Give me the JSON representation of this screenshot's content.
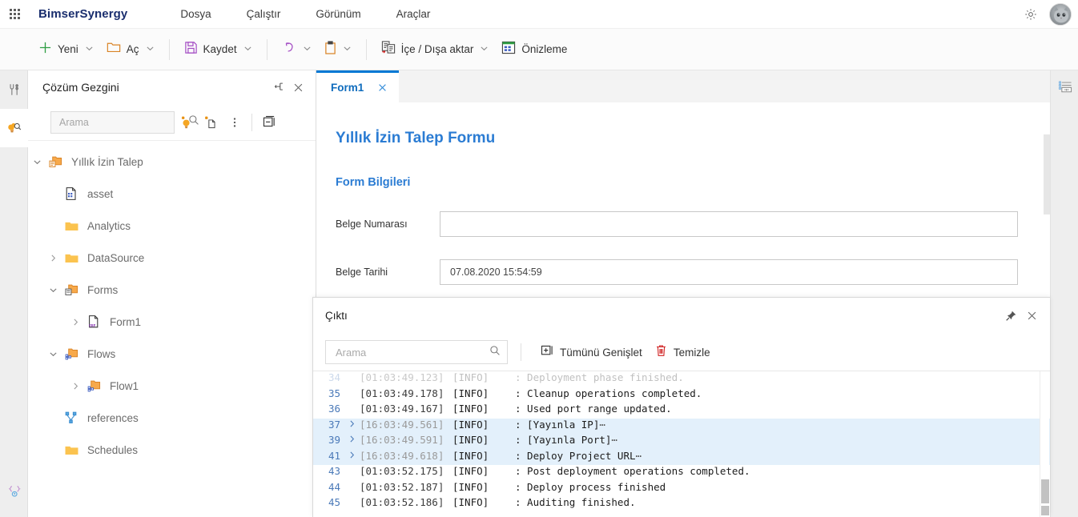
{
  "topbar": {
    "waffle_icon": "app-launcher-icon",
    "brand": "BimserSynergy",
    "menu": [
      {
        "label": "Dosya"
      },
      {
        "label": "Çalıştır"
      },
      {
        "label": "Görünüm"
      },
      {
        "label": "Araçlar"
      }
    ],
    "settings_icon": "gear-icon",
    "avatar_icon": "user-avatar"
  },
  "ribbon": {
    "items": [
      {
        "label": "Yeni",
        "icon": "plus-icon",
        "caret": true
      },
      {
        "label": "Aç",
        "icon": "folder-open-icon",
        "caret": true
      },
      {
        "label": "Kaydet",
        "icon": "save-floppy-icon",
        "caret": true
      },
      {
        "label": "",
        "icon": "undo-icon",
        "caret": true
      },
      {
        "label": "",
        "icon": "clipboard-paste-icon",
        "caret": true
      },
      {
        "label": "İçe / Dışa aktar",
        "icon": "import-export-icon",
        "caret": true
      },
      {
        "label": "Önizleme",
        "icon": "preview-grid-icon",
        "caret": false
      }
    ]
  },
  "left_rail": {
    "items": [
      {
        "name": "toolbox-icon",
        "active": false
      },
      {
        "name": "solution-explorer-icon",
        "active": true
      }
    ],
    "bottom_item": {
      "name": "code-braces-icon"
    }
  },
  "right_rail": {
    "items": [
      {
        "name": "properties-panel-icon"
      }
    ]
  },
  "explorer": {
    "title": "Çözüm Gezgini",
    "pin_icon": "pin-icon",
    "close_icon": "close-icon",
    "search": {
      "placeholder": "Arama",
      "value": "",
      "icon": "search-icon"
    },
    "toolbar_icons": [
      {
        "name": "new-item-bulb-icon"
      },
      {
        "name": "new-file-icon"
      },
      {
        "name": "more-options-icon"
      },
      {
        "name": "collapse-all-icon"
      }
    ],
    "tree": [
      {
        "label": "Yıllık İzin Talep",
        "level": 0,
        "chevron": "down",
        "icon": "solution-folder-icon"
      },
      {
        "label": "asset",
        "level": 1,
        "chevron": "none",
        "icon": "asset-file-icon"
      },
      {
        "label": "Analytics",
        "level": 1,
        "chevron": "none",
        "icon": "folder-icon"
      },
      {
        "label": "DataSource",
        "level": 1,
        "chevron": "right",
        "icon": "folder-icon"
      },
      {
        "label": "Forms",
        "level": 1,
        "chevron": "down",
        "icon": "forms-folder-icon"
      },
      {
        "label": "Form1",
        "level": 2,
        "chevron": "right",
        "icon": "erf-file-icon"
      },
      {
        "label": "Flows",
        "level": 1,
        "chevron": "down",
        "icon": "flows-folder-icon"
      },
      {
        "label": "Flow1",
        "level": 2,
        "chevron": "right",
        "icon": "flow-folder-icon"
      },
      {
        "label": "references",
        "level": 1,
        "chevron": "none",
        "icon": "references-icon"
      },
      {
        "label": "Schedules",
        "level": 1,
        "chevron": "none",
        "icon": "folder-icon"
      }
    ]
  },
  "editor": {
    "tabs": [
      {
        "label": "Form1",
        "active": true,
        "close_icon": "close-icon"
      }
    ],
    "form": {
      "title": "Yıllık İzin Talep Formu",
      "section": "Form Bilgileri",
      "fields": [
        {
          "label": "Belge Numarası",
          "value": ""
        },
        {
          "label": "Belge Tarihi",
          "value": "07.08.2020 15:54:59"
        }
      ]
    }
  },
  "output": {
    "title": "Çıktı",
    "pin_icon": "pin-icon",
    "close_icon": "close-icon",
    "search": {
      "placeholder": "Arama",
      "value": "",
      "icon": "search-icon"
    },
    "buttons": [
      {
        "label": "Tümünü Genişlet",
        "icon": "expand-all-icon"
      },
      {
        "label": "Temizle",
        "icon": "trash-icon"
      }
    ],
    "log": [
      {
        "num": "34",
        "chevron": false,
        "ts": "[01:03:49.123]",
        "level": "[INFO]",
        "msg": ": Deployment phase finished.",
        "highlight": false,
        "partial": true,
        "ellipsis": false
      },
      {
        "num": "35",
        "chevron": false,
        "ts": "[01:03:49.178]",
        "level": "[INFO]",
        "msg": ": Cleanup operations completed.",
        "highlight": false,
        "partial": false,
        "ellipsis": false
      },
      {
        "num": "36",
        "chevron": false,
        "ts": "[01:03:49.167]",
        "level": "[INFO]",
        "msg": ": Used port range updated.",
        "highlight": false,
        "partial": false,
        "ellipsis": false
      },
      {
        "num": "37",
        "chevron": true,
        "ts": "[16:03:49.561]",
        "level": "[INFO]",
        "msg": ": [Yayınla IP]",
        "highlight": true,
        "partial": false,
        "ellipsis": true
      },
      {
        "num": "39",
        "chevron": true,
        "ts": "[16:03:49.591]",
        "level": "[INFO]",
        "msg": ": [Yayınla Port]",
        "highlight": true,
        "partial": false,
        "ellipsis": true
      },
      {
        "num": "41",
        "chevron": true,
        "ts": "[16:03:49.618]",
        "level": "[INFO]",
        "msg": ": Deploy Project URL",
        "highlight": true,
        "partial": false,
        "ellipsis": true
      },
      {
        "num": "43",
        "chevron": false,
        "ts": "[01:03:52.175]",
        "level": "[INFO]",
        "msg": ": Post deployment operations completed.",
        "highlight": false,
        "partial": false,
        "ellipsis": false
      },
      {
        "num": "44",
        "chevron": false,
        "ts": "[01:03:52.187]",
        "level": "[INFO]",
        "msg": ": Deploy process finished",
        "highlight": false,
        "partial": false,
        "ellipsis": false
      },
      {
        "num": "45",
        "chevron": false,
        "ts": "[01:03:52.186]",
        "level": "[INFO]",
        "msg": ": Auditing finished.",
        "highlight": false,
        "partial": false,
        "ellipsis": false
      }
    ],
    "ellipsis_glyph": "⋯"
  },
  "colors": {
    "accent_blue": "#0f6cbd",
    "brand_navy": "#1a2e6e",
    "highlight_row": "#e3f0fb",
    "line_number": "#4a79b8",
    "form_heading": "#2b7cd3"
  }
}
